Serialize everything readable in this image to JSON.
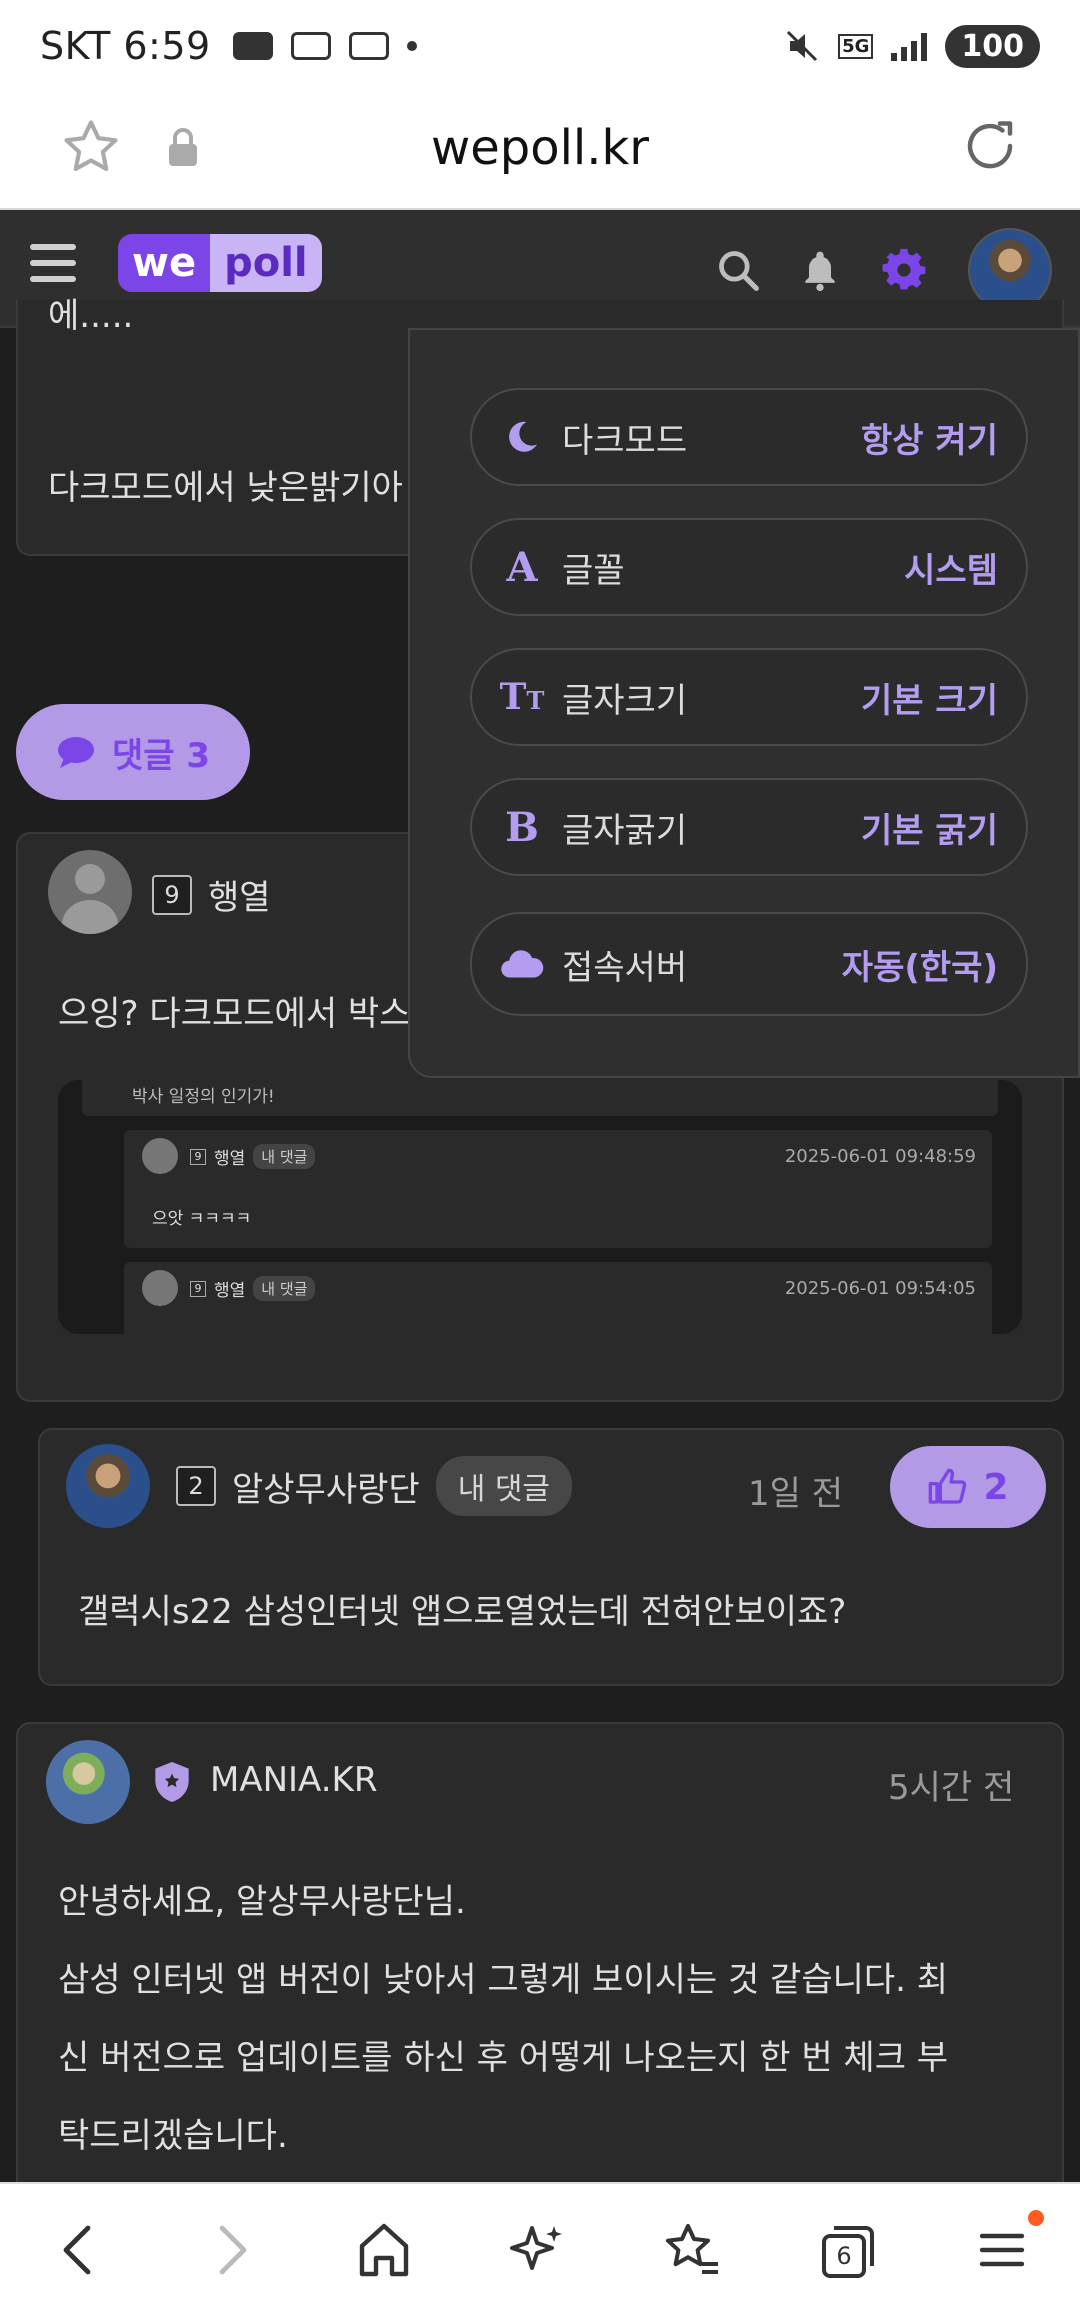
{
  "status_bar": {
    "carrier_time": "SKT 6:59",
    "network": "5G",
    "battery": "100"
  },
  "browser": {
    "url": "wepoll.kr"
  },
  "site": {
    "logo_we": "we",
    "logo_poll": "poll"
  },
  "post_fragment": {
    "cut_line": "에.....",
    "text": "다크모드에서 낮은밝기아"
  },
  "comments_button": {
    "label": "댓글 3"
  },
  "comment1": {
    "level": "9",
    "author": "행열",
    "text": "으잉? 다크모드에서 박스",
    "screenshot": {
      "top_text": "박사 일정의 인기가!",
      "rows": [
        {
          "level": "9",
          "author": "행열",
          "tag": "내 댓글",
          "time": "2025-06-01 09:48:59",
          "text": "으앗 ㅋㅋㅋㅋ"
        },
        {
          "level": "9",
          "author": "행열",
          "tag": "내 댓글",
          "time": "2025-06-01 09:54:05",
          "text": ""
        }
      ]
    }
  },
  "reply": {
    "level": "2",
    "author": "알상무사랑단",
    "tag": "내 댓글",
    "time": "1일 전",
    "likes": "2",
    "text": "갤럭시s22 삼성인터넷 앱으로열었는데 전혀안보이죠?"
  },
  "answer": {
    "author": "MANIA.KR",
    "time": "5시간 전",
    "lines": [
      "안녕하세요, 알상무사랑단님.",
      "삼성 인터넷 앱 버전이 낮아서 그렇게 보이시는 것 같습니다. 최",
      "신 버전으로 업데이트를 하신 후 어떻게 나오는지 한 번 체크 부",
      "탁드리겠습니다."
    ]
  },
  "settings": {
    "options": [
      {
        "icon": "moon-icon",
        "label": "다크모드",
        "value": "항상 켜기"
      },
      {
        "icon": "font-a-icon",
        "label": "글꼴",
        "value": "시스템"
      },
      {
        "icon": "text-size-icon",
        "label": "글자크기",
        "value": "기본 크기"
      },
      {
        "icon": "bold-b-icon",
        "label": "글자굵기",
        "value": "기본 굵기"
      },
      {
        "icon": "cloud-icon",
        "label": "접속서버",
        "value": "자동(한국)"
      }
    ]
  },
  "bottom_nav": {
    "tabs_count": "6"
  },
  "colors": {
    "accent": "#7c45e8",
    "accent_light": "#b39ae6",
    "page_bg": "#1e1e1e",
    "card_bg": "#2a2a2a"
  }
}
